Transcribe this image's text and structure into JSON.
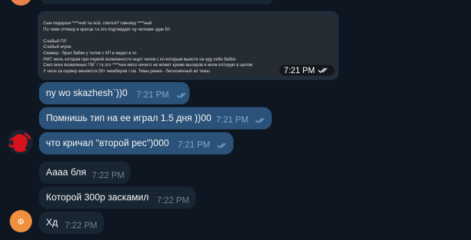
{
  "screenshot_message": {
    "lines": [
      "Сын пидарши ****ной ты всё, спился? говноед ****ный",
      "По теме отпишу в кратце т.к это подтвердят ну человек здак 50",
      "",
      "Слабый ПЛ",
      "Слабый игрок",
      "Скамер - брал бабки у типов с КП и кидал в чс",
      "РМТ моль которая при первой возможности ищет челов с кп которым выести на еду себе бабки",
      "Скип всех возможных ГВГ / т.к это ****нее мясо ничего не может кроме высеров и мочи которую в целом",
      "У чела за сервер меняется 50+ мемберов / см. Темы ранее - бесконечный ап темы"
    ],
    "time": "7:21 PM"
  },
  "messages": [
    {
      "text": "ny wo skazhesh`))0",
      "time": "7:21 PM"
    },
    {
      "text": "Помнишь тип на ее играл 1.5 дня ))00",
      "time": "7:21 PM"
    },
    {
      "text": "что кричал \"второй рес\")000",
      "time": "7:21 PM"
    },
    {
      "text": "Аааа бля",
      "time": "7:22 PM"
    },
    {
      "text": "Которой 300р заскамил",
      "time": "7:22 PM"
    },
    {
      "text": "Хд",
      "time": "7:22 PM"
    }
  ],
  "avatar_letter": "Ф",
  "colors": {
    "background": "#0e1621",
    "outgoing": "#2b5278",
    "incoming": "#182533",
    "accent": "#7da8d3"
  }
}
